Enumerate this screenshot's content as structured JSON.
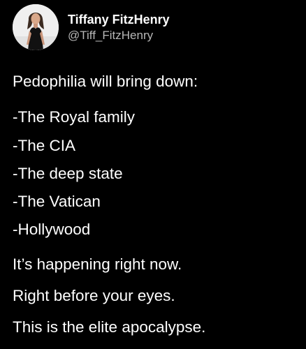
{
  "tweet": {
    "author": {
      "display_name": "Tiffany FitzHenry",
      "handle": "@Tiff_FitzHenry"
    },
    "lines": [
      "Pedophilia will bring down:",
      "-The Royal family",
      "-The CIA",
      "-The deep state",
      "-The Vatican",
      "-Hollywood",
      "It’s happening right now.",
      "Right before your eyes.",
      "This is the elite apocalypse."
    ]
  },
  "colors": {
    "background": "#000000",
    "text": "#ffffff",
    "handle": "#b7b7b7"
  }
}
